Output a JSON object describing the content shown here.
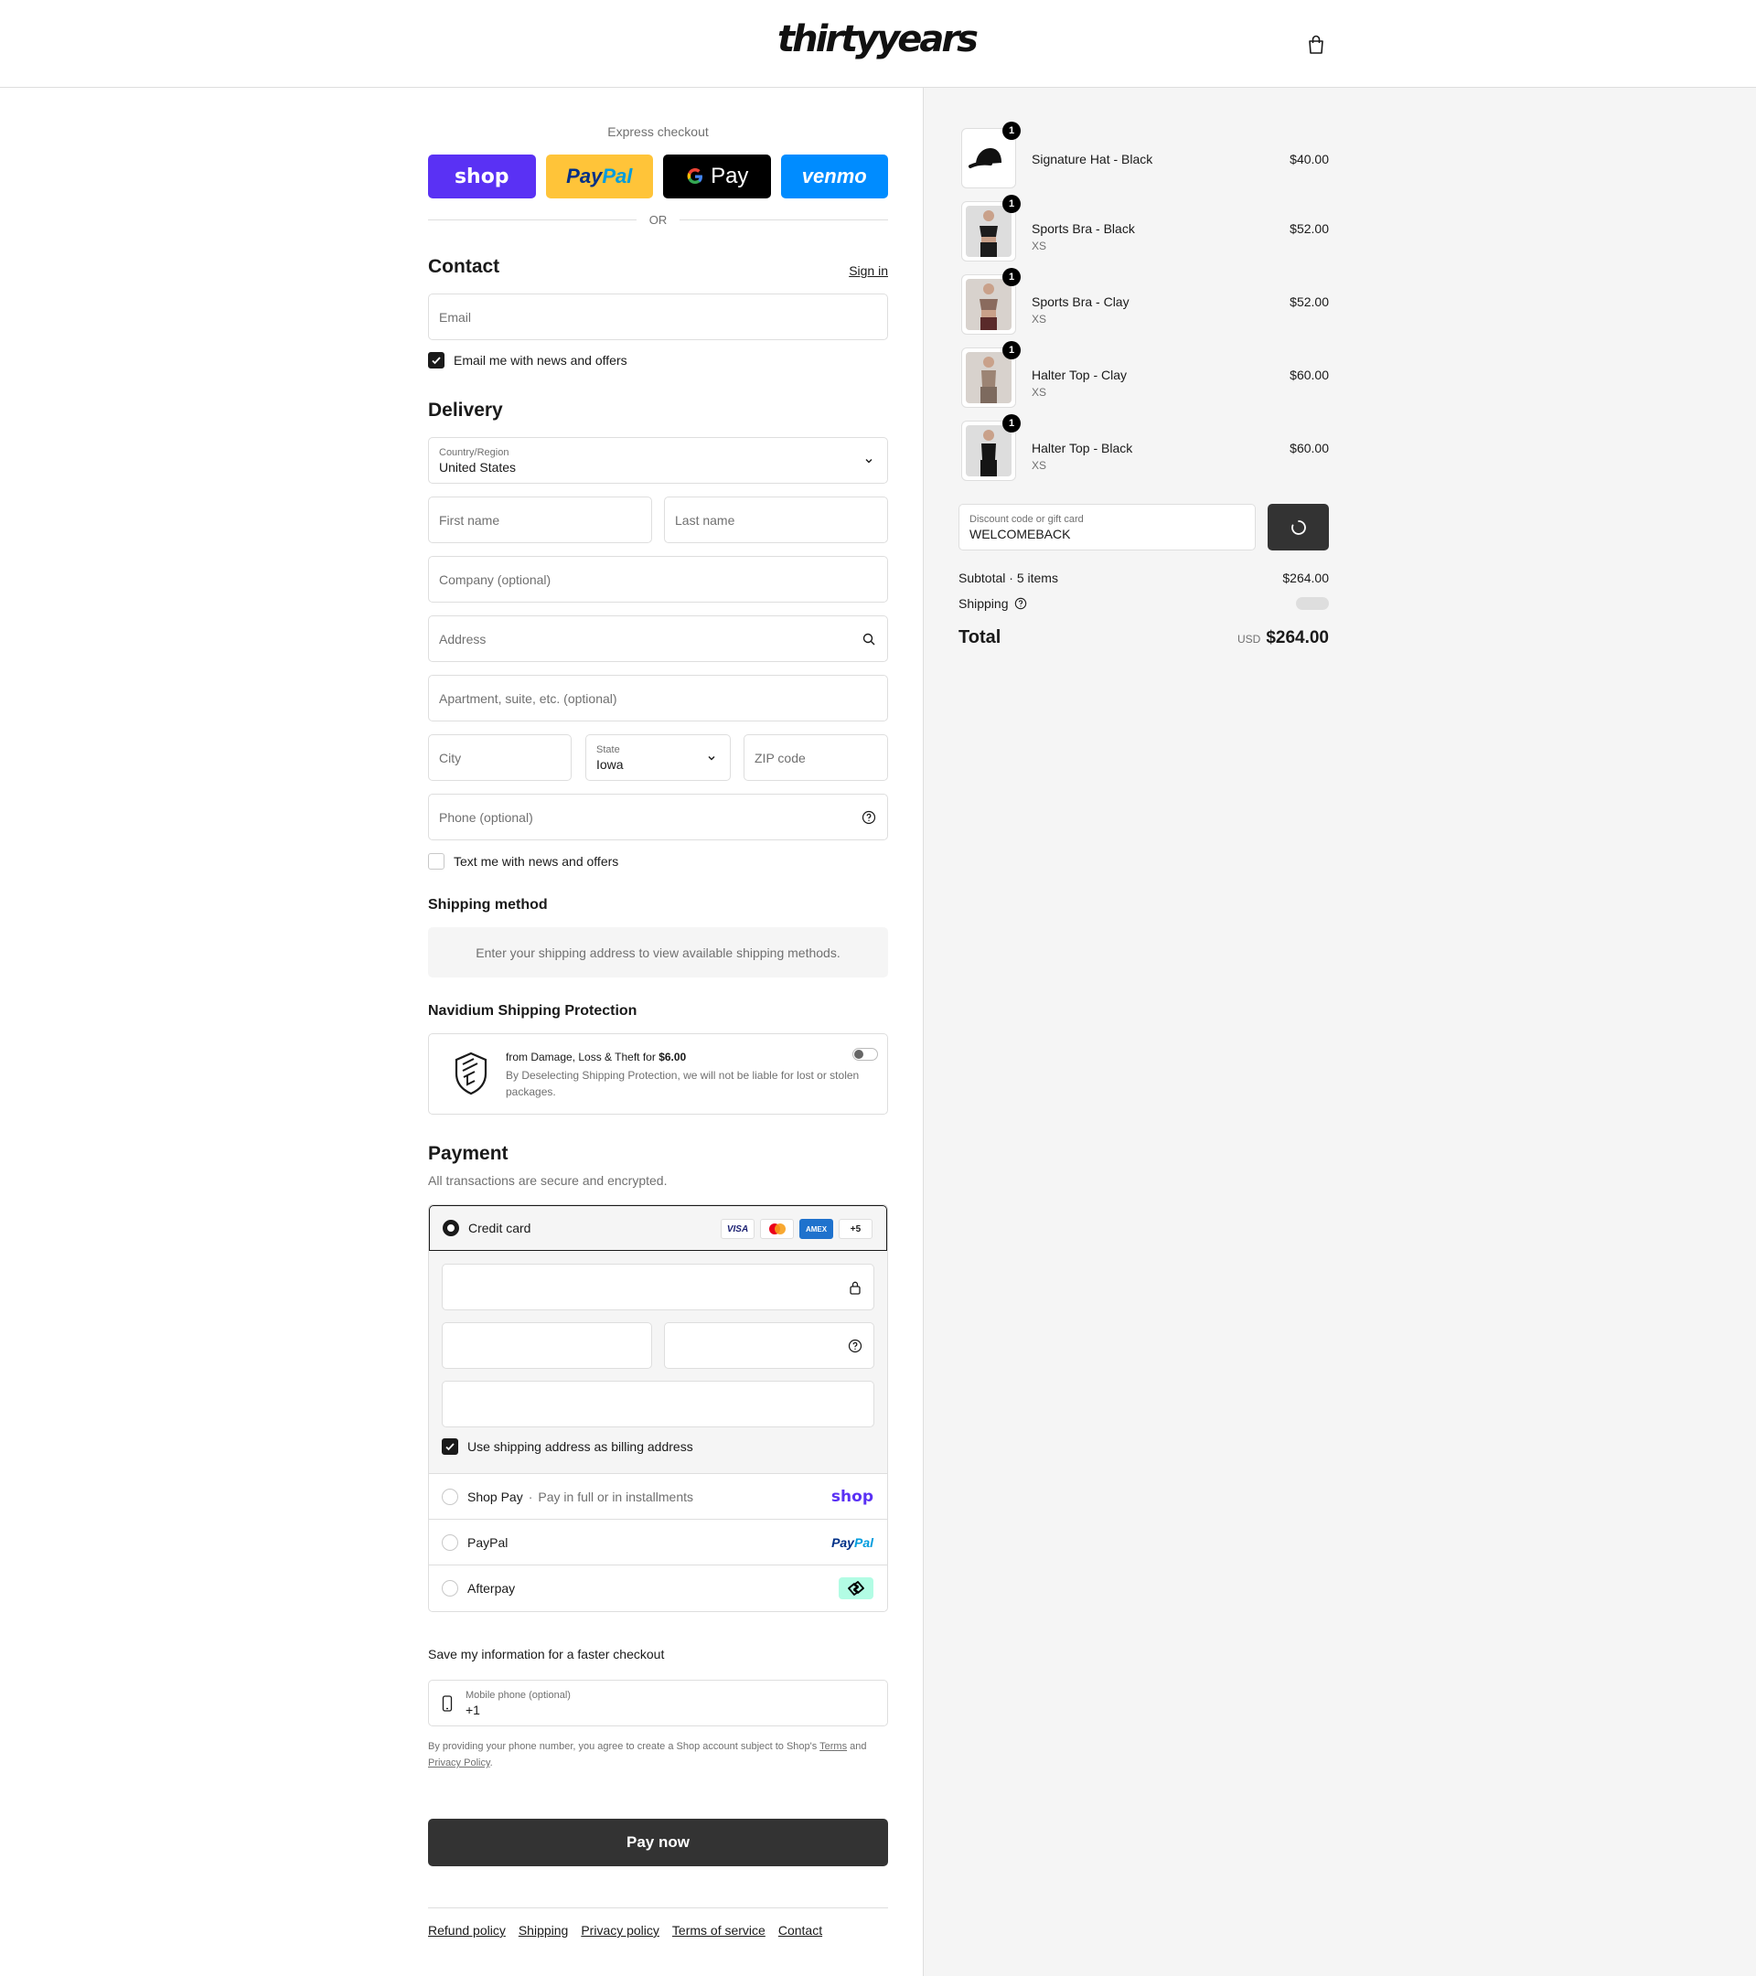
{
  "header": {
    "logo": "thirtyyears",
    "cart_icon": "bag-icon"
  },
  "express": {
    "title": "Express checkout",
    "buttons": {
      "shop": "shop",
      "paypal_1": "Pay",
      "paypal_2": "Pal",
      "gpay": "Pay",
      "venmo": "venmo"
    },
    "or": "OR"
  },
  "contact": {
    "title": "Contact",
    "sign_in": "Sign in",
    "email_placeholder": "Email",
    "email_optin": "Email me with news and offers",
    "email_optin_checked": true
  },
  "delivery": {
    "title": "Delivery",
    "country_label": "Country/Region",
    "country_value": "United States",
    "first_name": "First name",
    "last_name": "Last name",
    "company": "Company (optional)",
    "address": "Address",
    "apartment": "Apartment, suite, etc. (optional)",
    "city": "City",
    "state_label": "State",
    "state_value": "Iowa",
    "zip": "ZIP code",
    "phone": "Phone (optional)",
    "text_optin": "Text me with news and offers",
    "text_optin_checked": false
  },
  "shipping_method": {
    "title": "Shipping method",
    "message": "Enter your shipping address to view available shipping methods."
  },
  "protection": {
    "title": "Navidium Shipping Protection",
    "line1": "from Damage, Loss & Theft for",
    "price": "$6.00",
    "line2": "By Deselecting Shipping Protection, we will not be liable for lost or stolen packages.",
    "enabled": false
  },
  "payment": {
    "title": "Payment",
    "subtitle": "All transactions are secure and encrypted.",
    "credit_card": "Credit card",
    "card_brands": [
      "VISA",
      "",
      "AMEX",
      "+5"
    ],
    "billing_same": "Use shipping address as billing address",
    "shop_pay": "Shop Pay",
    "shop_pay_sep": "·",
    "shop_pay_note": "Pay in full or in installments",
    "shop_brand": "shop",
    "paypal": "PayPal",
    "paypal_brand_1": "Pay",
    "paypal_brand_2": "Pal",
    "afterpay": "Afterpay"
  },
  "save_info": {
    "title": "Save my information for a faster checkout",
    "phone_label": "Mobile phone (optional)",
    "phone_value": "+1",
    "legal_1": "By providing your phone number, you agree to create a Shop account subject to Shop's",
    "terms": "Terms",
    "legal_and": "and",
    "privacy": "Privacy Policy",
    "legal_end": "."
  },
  "pay_now": "Pay now",
  "footer_links": [
    "Refund policy",
    "Shipping",
    "Privacy policy",
    "Terms of service",
    "Contact"
  ],
  "cart": {
    "items": [
      {
        "name": "Signature Hat - Black",
        "variant": "",
        "price": "$40.00",
        "qty": "1",
        "color": "#111111"
      },
      {
        "name": "Sports Bra - Black",
        "variant": "XS",
        "price": "$52.00",
        "qty": "1",
        "color": "#1c1c1c"
      },
      {
        "name": "Sports Bra - Clay",
        "variant": "XS",
        "price": "$52.00",
        "qty": "1",
        "color": "#8a6b5e"
      },
      {
        "name": "Halter Top - Clay",
        "variant": "XS",
        "price": "$60.00",
        "qty": "1",
        "color": "#9c8474"
      },
      {
        "name": "Halter Top - Black",
        "variant": "XS",
        "price": "$60.00",
        "qty": "1",
        "color": "#151515"
      }
    ],
    "discount_label": "Discount code or gift card",
    "discount_value": "WELCOMEBACK",
    "subtotal_label": "Subtotal · 5 items",
    "subtotal_value": "$264.00",
    "shipping_label": "Shipping",
    "total_label": "Total",
    "currency": "USD",
    "total_value": "$264.00"
  },
  "colors": {
    "accent": "#333333",
    "shop": "#5a31f4",
    "paypal": "#ffc439",
    "venmo": "#008cff",
    "afterpay": "#b2fce4"
  }
}
